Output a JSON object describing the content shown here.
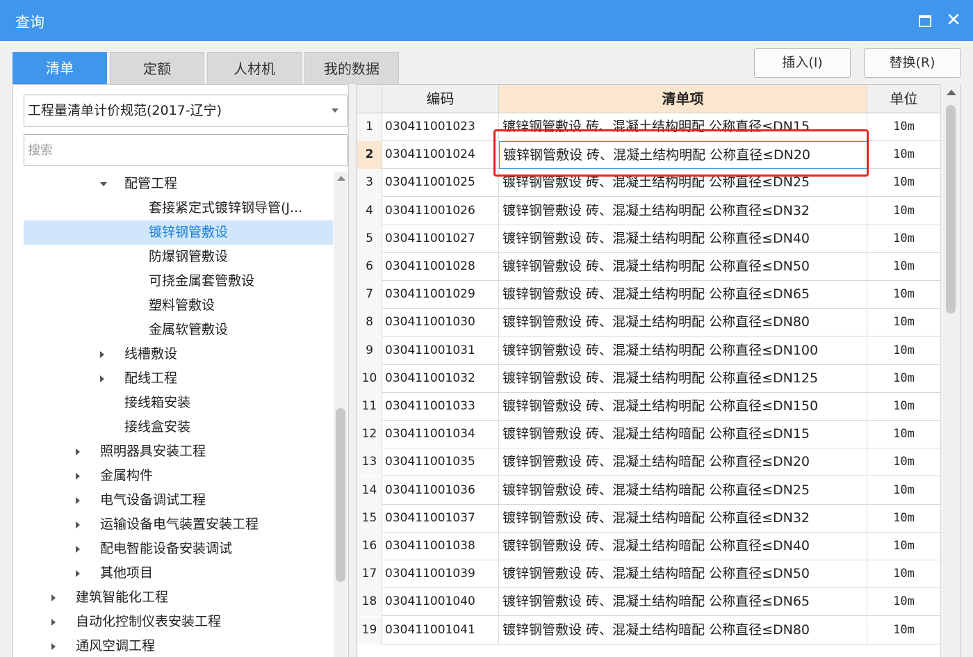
{
  "window": {
    "title": "查询"
  },
  "tabs": [
    {
      "label": "清单"
    },
    {
      "label": "定额"
    },
    {
      "label": "人材机"
    },
    {
      "label": "我的数据"
    }
  ],
  "actions": {
    "insert_label": "插入(I)",
    "replace_label": "替换(R)"
  },
  "left": {
    "spec_select": "工程量清单计价规范(2017-辽宁)",
    "search_placeholder": "搜索",
    "tree": [
      {
        "label": "配管工程",
        "state": "expanded"
      },
      {
        "label": "套接紧定式镀锌钢导管(J...",
        "state": "leaf"
      },
      {
        "label": "镀锌钢管敷设",
        "state": "leaf",
        "selected": true
      },
      {
        "label": "防爆钢管敷设",
        "state": "leaf"
      },
      {
        "label": "可挠金属套管敷设",
        "state": "leaf"
      },
      {
        "label": "塑料管敷设",
        "state": "leaf"
      },
      {
        "label": "金属软管敷设",
        "state": "leaf"
      },
      {
        "label": "线槽敷设",
        "state": "collapsed"
      },
      {
        "label": "配线工程",
        "state": "collapsed"
      },
      {
        "label": "接线箱安装",
        "state": "leaf"
      },
      {
        "label": "接线盒安装",
        "state": "leaf"
      },
      {
        "label": "照明器具安装工程",
        "state": "collapsed"
      },
      {
        "label": "金属构件",
        "state": "collapsed"
      },
      {
        "label": "电气设备调试工程",
        "state": "collapsed"
      },
      {
        "label": "运输设备电气装置安装工程",
        "state": "collapsed"
      },
      {
        "label": "配电智能设备安装调试",
        "state": "collapsed"
      },
      {
        "label": "其他项目",
        "state": "collapsed"
      },
      {
        "label": "建筑智能化工程",
        "state": "collapsed"
      },
      {
        "label": "自动化控制仪表安装工程",
        "state": "collapsed"
      },
      {
        "label": "通风空调工程",
        "state": "collapsed"
      }
    ]
  },
  "grid": {
    "headers": {
      "code": "编码",
      "item": "清单项",
      "unit": "单位"
    },
    "current_row": 2,
    "rows": [
      {
        "idx": "1",
        "code": "030411001023",
        "name": "镀锌钢管敷设 砖、混凝土结构明配 公称直径≤DN15",
        "unit": "10m"
      },
      {
        "idx": "2",
        "code": "030411001024",
        "name": "镀锌钢管敷设 砖、混凝土结构明配 公称直径≤DN20",
        "unit": "10m"
      },
      {
        "idx": "3",
        "code": "030411001025",
        "name": "镀锌钢管敷设 砖、混凝土结构明配 公称直径≤DN25",
        "unit": "10m"
      },
      {
        "idx": "4",
        "code": "030411001026",
        "name": "镀锌钢管敷设 砖、混凝土结构明配 公称直径≤DN32",
        "unit": "10m"
      },
      {
        "idx": "5",
        "code": "030411001027",
        "name": "镀锌钢管敷设 砖、混凝土结构明配 公称直径≤DN40",
        "unit": "10m"
      },
      {
        "idx": "6",
        "code": "030411001028",
        "name": "镀锌钢管敷设 砖、混凝土结构明配 公称直径≤DN50",
        "unit": "10m"
      },
      {
        "idx": "7",
        "code": "030411001029",
        "name": "镀锌钢管敷设 砖、混凝土结构明配 公称直径≤DN65",
        "unit": "10m"
      },
      {
        "idx": "8",
        "code": "030411001030",
        "name": "镀锌钢管敷设 砖、混凝土结构明配 公称直径≤DN80",
        "unit": "10m"
      },
      {
        "idx": "9",
        "code": "030411001031",
        "name": "镀锌钢管敷设 砖、混凝土结构明配 公称直径≤DN100",
        "unit": "10m"
      },
      {
        "idx": "10",
        "code": "030411001032",
        "name": "镀锌钢管敷设 砖、混凝土结构明配 公称直径≤DN125",
        "unit": "10m"
      },
      {
        "idx": "11",
        "code": "030411001033",
        "name": "镀锌钢管敷设 砖、混凝土结构明配 公称直径≤DN150",
        "unit": "10m"
      },
      {
        "idx": "12",
        "code": "030411001034",
        "name": "镀锌钢管敷设 砖、混凝土结构暗配 公称直径≤DN15",
        "unit": "10m"
      },
      {
        "idx": "13",
        "code": "030411001035",
        "name": "镀锌钢管敷设 砖、混凝土结构暗配 公称直径≤DN20",
        "unit": "10m"
      },
      {
        "idx": "14",
        "code": "030411001036",
        "name": "镀锌钢管敷设 砖、混凝土结构暗配 公称直径≤DN25",
        "unit": "10m"
      },
      {
        "idx": "15",
        "code": "030411001037",
        "name": "镀锌钢管敷设 砖、混凝土结构暗配 公称直径≤DN32",
        "unit": "10m"
      },
      {
        "idx": "16",
        "code": "030411001038",
        "name": "镀锌钢管敷设 砖、混凝土结构暗配 公称直径≤DN40",
        "unit": "10m"
      },
      {
        "idx": "17",
        "code": "030411001039",
        "name": "镀锌钢管敷设 砖、混凝土结构暗配 公称直径≤DN50",
        "unit": "10m"
      },
      {
        "idx": "18",
        "code": "030411001040",
        "name": "镀锌钢管敷设 砖、混凝土结构暗配 公称直径≤DN65",
        "unit": "10m"
      },
      {
        "idx": "19",
        "code": "030411001041",
        "name": "镀锌钢管敷设 砖、混凝土结构暗配 公称直径≤DN80",
        "unit": "10m"
      }
    ]
  },
  "colors": {
    "accent": "#3f96ea",
    "header_highlight": "#fbe7cf",
    "annotation": "#e8231b"
  }
}
